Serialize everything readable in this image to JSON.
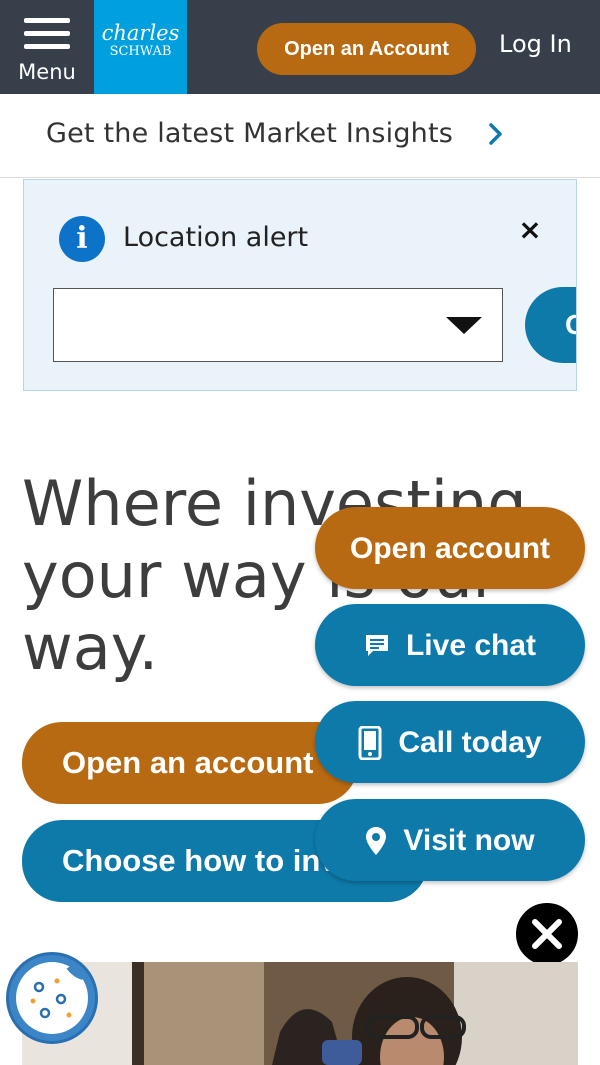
{
  "header": {
    "menu_label": "Menu",
    "logo_top": "charles",
    "logo_bottom": "SCHWAB",
    "open_account_label": "Open an Account",
    "login_label": "Log In"
  },
  "insights": {
    "text": "Get the latest Market Insights"
  },
  "location_alert": {
    "title": "Location alert",
    "close_label": "×",
    "select_value": "",
    "go_label": "Go"
  },
  "hero": {
    "headline": "Where investing your way is our way.",
    "open_account_label": "Open an account",
    "choose_label": "Choose how to invest"
  },
  "floating_actions": {
    "open_account": "Open account",
    "live_chat": "Live chat",
    "call_today": "Call today",
    "visit_now": "Visit now"
  },
  "colors": {
    "header_bg": "#37404a",
    "brand_blue": "#00a0df",
    "accent_orange": "#b86a12",
    "button_blue": "#0e7aaa",
    "alert_bg": "#eaf2fa",
    "info_blue": "#0d73c9"
  }
}
